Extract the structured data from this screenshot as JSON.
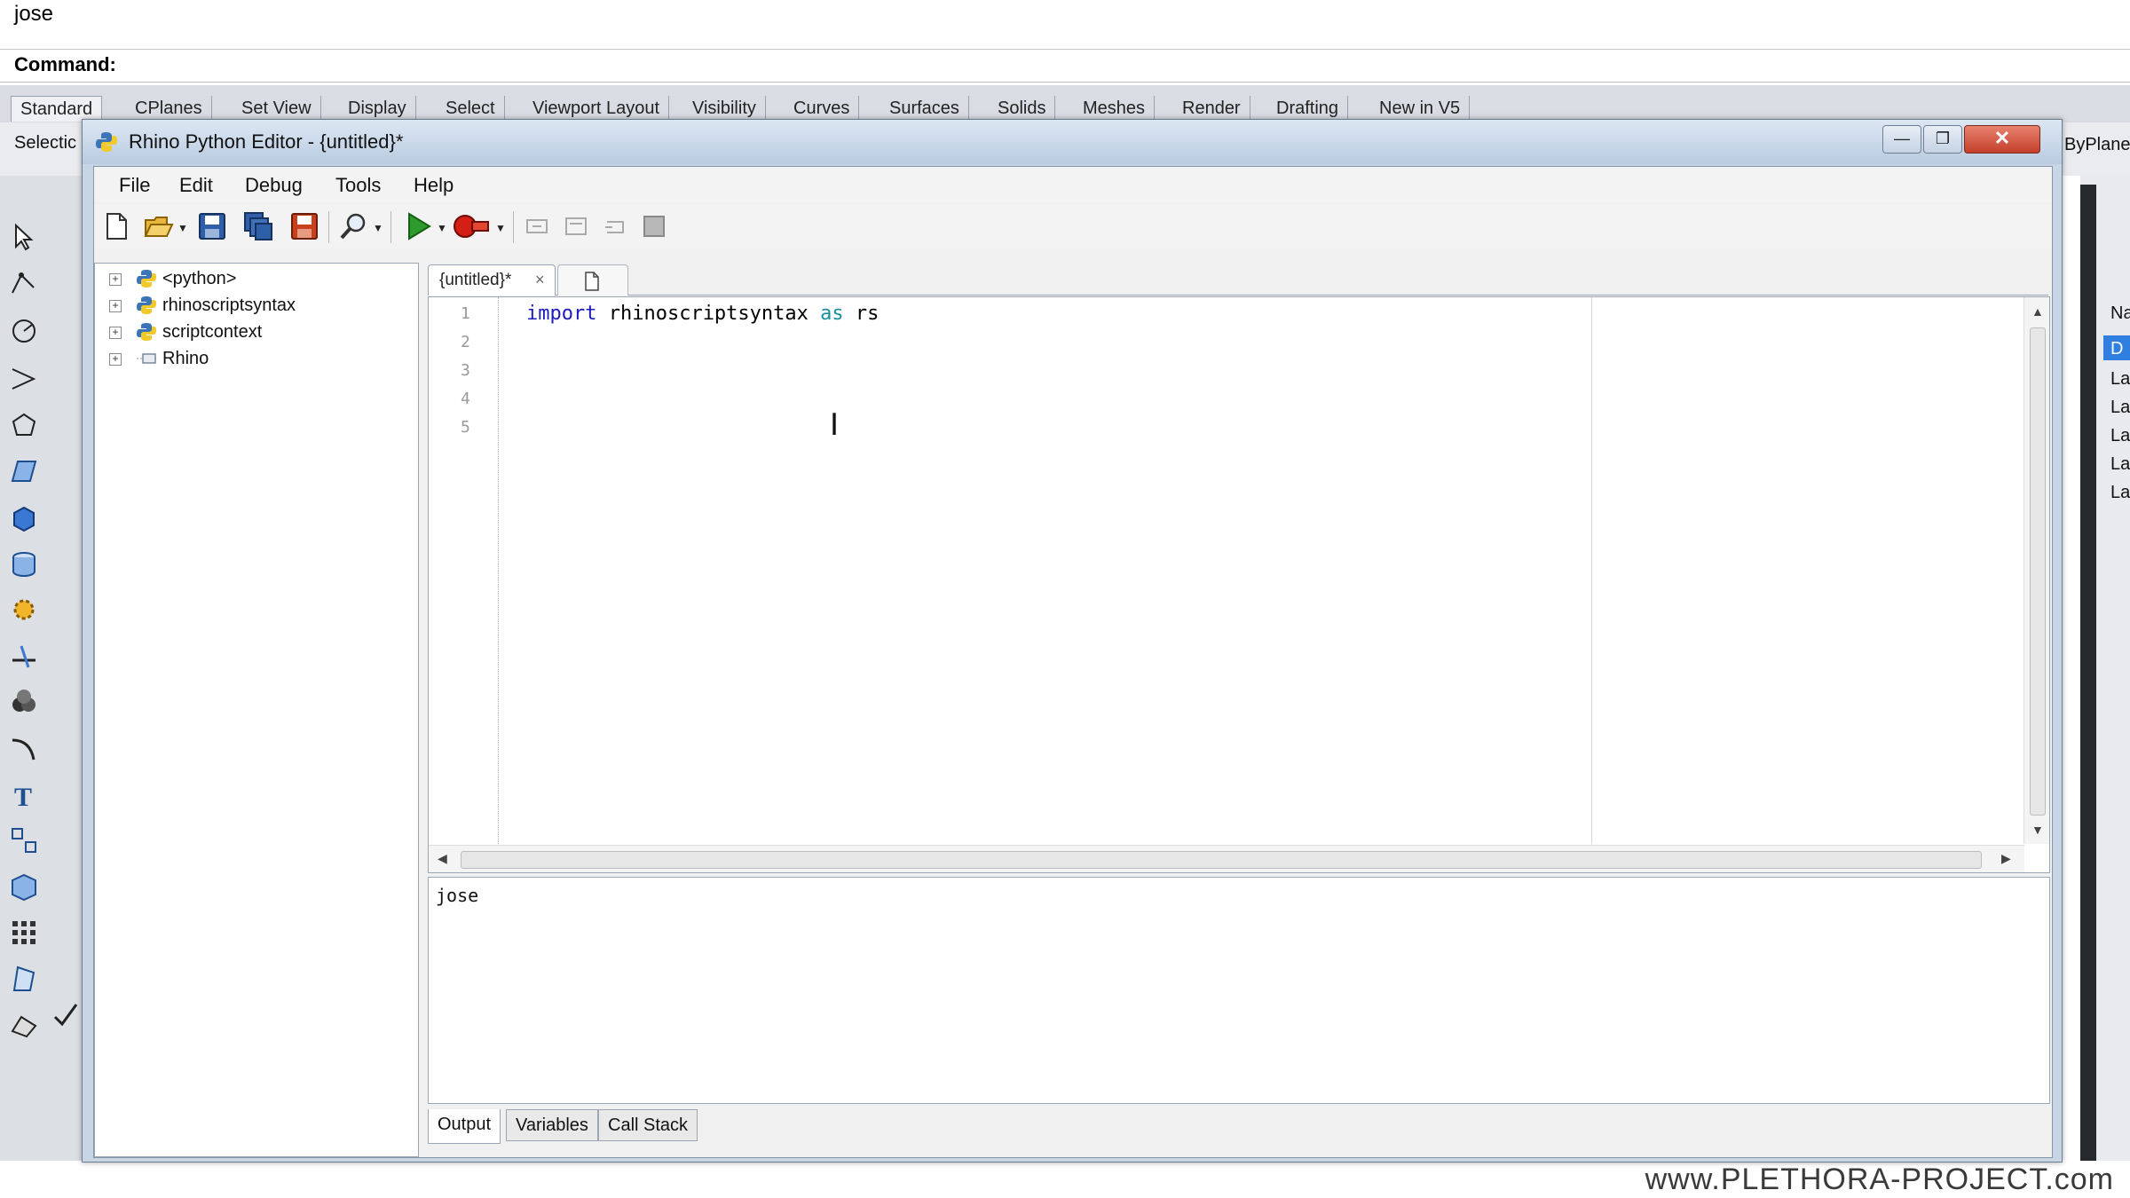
{
  "rhino": {
    "history_text": "jose",
    "command_label": "Command:",
    "tabs": [
      "Standard",
      "CPlanes",
      "Set View",
      "Display",
      "Select",
      "Viewport Layout",
      "Visibility",
      "Curves",
      "Surfaces",
      "Solids",
      "Meshes",
      "Render",
      "Drafting",
      "New in V5"
    ],
    "row2_left": "Selectic",
    "row2_right": "ByPlane",
    "right_panel_items": [
      "Na",
      "D",
      "La",
      "La",
      "La",
      "La",
      "La"
    ]
  },
  "editor": {
    "title": "Rhino Python Editor - {untitled}*",
    "window_buttons": {
      "minimize": "—",
      "restore": "❐",
      "close": "✕"
    },
    "menu": [
      "File",
      "Edit",
      "Debug",
      "Tools",
      "Help"
    ],
    "toolbar_icons": [
      "new-file-icon",
      "open-folder-icon",
      "save-icon",
      "save-all-icon",
      "save-as-icon",
      "find-icon",
      "run-icon",
      "breakpoint-icon",
      "step-into-icon",
      "step-over-icon",
      "step-out-icon",
      "stop-icon"
    ],
    "tree": [
      {
        "label": "<python>",
        "icon": "python-icon"
      },
      {
        "label": "rhinoscriptsyntax",
        "icon": "python-icon"
      },
      {
        "label": "scriptcontext",
        "icon": "python-icon"
      },
      {
        "label": "Rhino",
        "icon": "folder-icon"
      }
    ],
    "doc_tab": {
      "label": "{untitled}*",
      "close": "×"
    },
    "line_numbers": [
      "1",
      "2",
      "3",
      "4",
      "5"
    ],
    "code": {
      "kw_import": "import",
      "module": " rhinoscriptsyntax ",
      "kw_as": "as",
      "alias": " rs"
    },
    "output_text": "jose",
    "bottom_tabs": [
      "Output",
      "Variables",
      "Call Stack"
    ],
    "colors": {
      "keyword": "#1c1cbd",
      "keyword_as": "#1a8f9c",
      "title_bar": "#c8d5e5",
      "close_button": "#c33f2b"
    }
  },
  "watermark": "www.PLETHORA-PROJECT.com"
}
